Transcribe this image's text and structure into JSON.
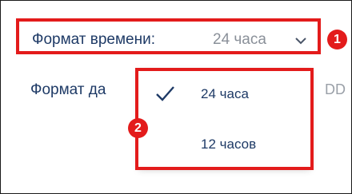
{
  "settings": {
    "time_format_label": "Формат времени:",
    "time_format_value": "24 часа",
    "date_format_label": "Формат да",
    "date_format_value": "DD"
  },
  "dropdown": {
    "options": [
      {
        "label": "24 часа",
        "selected": true
      },
      {
        "label": "12 часов",
        "selected": false
      }
    ]
  },
  "annotations": {
    "badge1": "1",
    "badge2": "2"
  },
  "colors": {
    "highlight": "#e31b1b",
    "label_text": "#1e3a66",
    "value_text": "#8a9099"
  },
  "icons": {
    "chevron": "chevron-down-icon",
    "check": "checkmark-icon"
  }
}
